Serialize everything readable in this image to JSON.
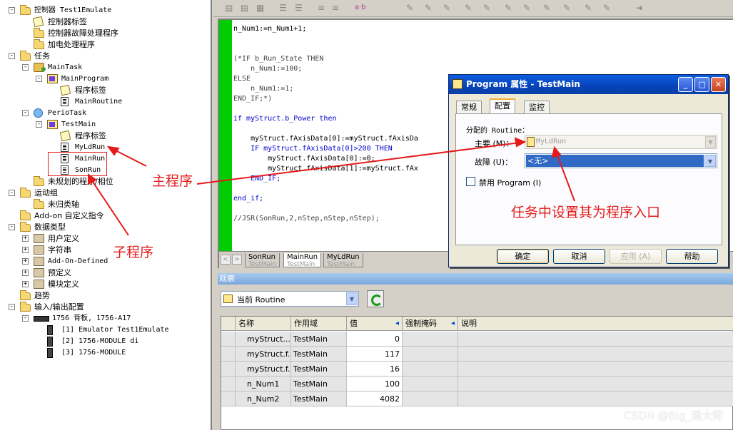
{
  "tree": {
    "nodes": [
      {
        "label": "控制器 Test1Emulate",
        "exp": "-",
        "icon": "folder"
      },
      {
        "label": "控制器标签",
        "icon": "tag"
      },
      {
        "label": "控制器故障处理程序",
        "icon": "folder"
      },
      {
        "label": "加电处理程序",
        "icon": "folder"
      },
      {
        "label": "任务",
        "exp": "-",
        "icon": "folder"
      },
      {
        "label": "MainTask",
        "exp": "-",
        "icon": "task"
      },
      {
        "label": "MainProgram",
        "exp": "-",
        "icon": "prog"
      },
      {
        "label": "程序标签",
        "icon": "tag"
      },
      {
        "label": "MainRoutine",
        "icon": "rout"
      },
      {
        "label": "PerioTask",
        "exp": "-",
        "icon": "clock"
      },
      {
        "label": "TestMain",
        "exp": "-",
        "icon": "prog"
      },
      {
        "label": "程序标签",
        "icon": "tag"
      },
      {
        "label": "MyLdRun",
        "icon": "rout"
      },
      {
        "label": "MainRun",
        "icon": "rout"
      },
      {
        "label": "SonRun",
        "icon": "rout"
      },
      {
        "label": "未规划的程序/相位",
        "icon": "folder"
      },
      {
        "label": "运动组",
        "exp": "-",
        "icon": "folder"
      },
      {
        "label": "未归类轴",
        "icon": "folder"
      },
      {
        "label": "Add-on 自定义指令",
        "icon": "folder"
      },
      {
        "label": "数据类型",
        "exp": "-",
        "icon": "folder"
      },
      {
        "label": "用户定义",
        "exp": "+",
        "icon": "dtype"
      },
      {
        "label": "字符串",
        "exp": "+",
        "icon": "dtype"
      },
      {
        "label": "Add-On-Defined",
        "exp": "+",
        "icon": "dtype"
      },
      {
        "label": "预定义",
        "exp": "+",
        "icon": "dtype"
      },
      {
        "label": "模块定义",
        "exp": "+",
        "icon": "dtype"
      },
      {
        "label": "趋势",
        "icon": "folder"
      },
      {
        "label": "输入/输出配置",
        "exp": "-",
        "icon": "folder"
      },
      {
        "label": "1756 背板, 1756-A17",
        "exp": "-",
        "icon": "rack"
      },
      {
        "label": "[1] Emulator Test1Emulate",
        "icon": "module"
      },
      {
        "label": "[2] 1756-MODULE di",
        "icon": "module"
      },
      {
        "label": "[3] 1756-MODULE",
        "icon": "module"
      }
    ]
  },
  "toolbar": {
    "ab_label": "a·b"
  },
  "editor": {
    "lines": [
      {
        "text": "n_Num1:=n_Num1+1;",
        "c": ""
      },
      {
        "text": "",
        "c": ""
      },
      {
        "text": "",
        "c": ""
      },
      {
        "text": "(*IF b_Run_State THEN",
        "c": "gray"
      },
      {
        "text": "    n_Num1:=100;",
        "c": "gray"
      },
      {
        "text": "ELSE",
        "c": "gray"
      },
      {
        "text": "    n_Num1:=1;",
        "c": "gray"
      },
      {
        "text": "END_IF;*)",
        "c": "gray"
      },
      {
        "text": "",
        "c": ""
      },
      {
        "text": "if myStruct.b_Power then",
        "c": "blue"
      },
      {
        "text": "",
        "c": ""
      },
      {
        "text": "    myStruct.fAxisData[0]:=myStruct.fAxisDa",
        "c": ""
      },
      {
        "text": "    IF myStruct.fAxisData[0]>200 THEN",
        "c": "blue"
      },
      {
        "text": "        myStruct.fAxisData[0]:=0;",
        "c": ""
      },
      {
        "text": "        myStruct.fAxisData[1]:=myStruct.fAx",
        "c": ""
      },
      {
        "text": "    END_IF;",
        "c": "blue"
      },
      {
        "text": "",
        "c": ""
      },
      {
        "text": "end_if;",
        "c": "blue"
      },
      {
        "text": "",
        "c": ""
      },
      {
        "text": "//JSR(SonRun,2,nStep,nStep,nStep);",
        "c": "gray"
      }
    ],
    "tabs": [
      {
        "name": "SonRun",
        "sub": "TestMain"
      },
      {
        "name": "MainRun",
        "sub": "TestMain"
      },
      {
        "name": "MyLdRun",
        "sub": "TestMain"
      }
    ]
  },
  "watch": {
    "title": "观察",
    "scope": "当前 Routine",
    "headers": [
      "名称",
      "作用域",
      "值",
      "强制掩码",
      "说明"
    ],
    "rows": [
      {
        "name": "myStruct....",
        "scope": "TestMain",
        "value": "0",
        "exp": ""
      },
      {
        "name": "myStruct.f...",
        "scope": "TestMain",
        "value": "117",
        "exp": "+"
      },
      {
        "name": "myStruct.f...",
        "scope": "TestMain",
        "value": "16",
        "exp": "+"
      },
      {
        "name": "n_Num1",
        "scope": "TestMain",
        "value": "100",
        "exp": "+"
      },
      {
        "name": "n_Num2",
        "scope": "TestMain",
        "value": "4082",
        "exp": "+"
      }
    ]
  },
  "dialog": {
    "title": "Program 属性 - TestMain",
    "tabs": [
      "常规",
      "配置",
      "监控"
    ],
    "assigned_label": "分配的 Routine：",
    "main_label": "主要 (M)：",
    "main_value": "MyLdRun",
    "fault_label": "故障 (U)：",
    "fault_value": "<无>",
    "inhibit_label": "禁用 Program (I)",
    "buttons": {
      "ok": "确定",
      "cancel": "取消",
      "apply": "应用 (A)",
      "help": "帮助"
    }
  },
  "annotations": {
    "main_program": "主程序",
    "sub_program": "子程序",
    "entry": "任务中设置其为程序入口",
    "color": "#e41b1b"
  },
  "watermark": "CSDN @Big_潘大师"
}
